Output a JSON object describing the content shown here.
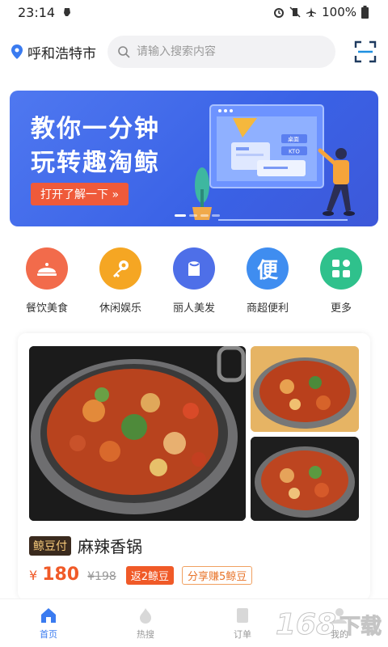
{
  "status_bar": {
    "time": "23:14",
    "battery": "100%"
  },
  "header": {
    "city": "呼和浩特市",
    "search_placeholder": "请输入搜索内容"
  },
  "banner": {
    "title_line1": "教你一分钟",
    "title_line2": "玩转趣淘鲸",
    "button_label": "打开了解一下 »",
    "screen_tag1": "桌面",
    "screen_tag2": "KTO"
  },
  "categories": [
    {
      "label": "餐饮美食",
      "icon": "food-cloche-icon",
      "color": "#f26b4b"
    },
    {
      "label": "休闲娱乐",
      "icon": "key-icon",
      "color": "#f5a623"
    },
    {
      "label": "丽人美发",
      "icon": "beauty-icon",
      "color": "#4e6fe8"
    },
    {
      "label": "商超便利",
      "icon": "convenience-icon",
      "color": "#3f8df0",
      "glyph": "便"
    },
    {
      "label": "更多",
      "icon": "grid-more-icon",
      "color": "#2fc18c"
    }
  ],
  "product": {
    "pay_tag": "鲸豆付",
    "name": "麻辣香锅",
    "currency": "¥",
    "price": "180",
    "original_price": "¥198",
    "rebate_badge": "返2鲸豆",
    "share_badge": "分享赚5鲸豆"
  },
  "bottom_nav": [
    {
      "label": "首页",
      "icon": "home-icon",
      "active": true
    },
    {
      "label": "热搜",
      "icon": "flame-icon",
      "active": false
    },
    {
      "label": "订单",
      "icon": "order-icon",
      "active": false
    },
    {
      "label": "我的",
      "icon": "profile-icon",
      "active": false
    }
  ],
  "watermark": {
    "digits": "168",
    "text": "下载"
  }
}
